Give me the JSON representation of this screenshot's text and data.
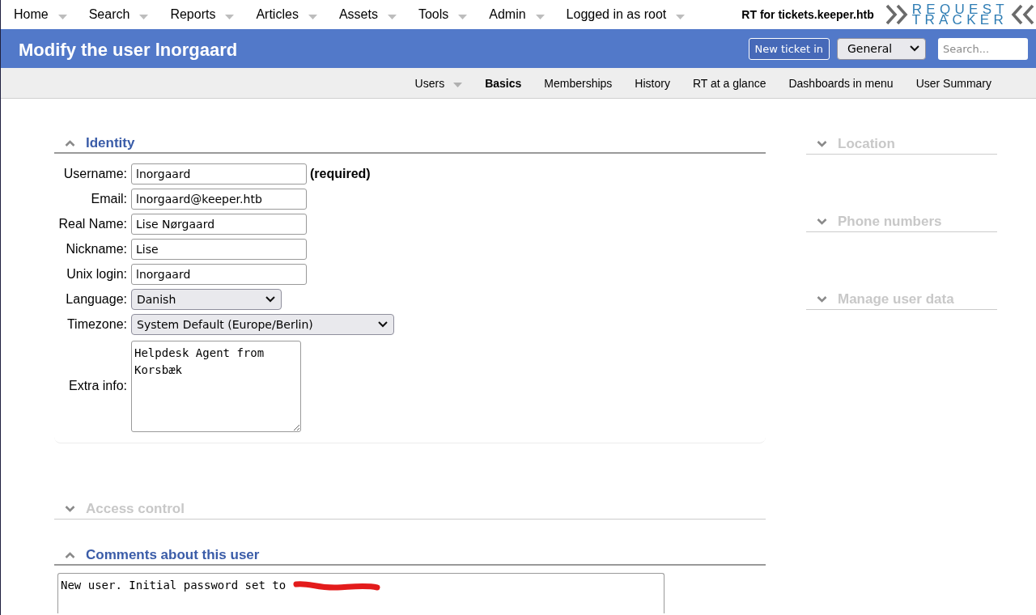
{
  "top_menu": [
    {
      "label": "Home"
    },
    {
      "label": "Search"
    },
    {
      "label": "Reports"
    },
    {
      "label": "Articles"
    },
    {
      "label": "Assets"
    },
    {
      "label": "Tools"
    },
    {
      "label": "Admin"
    },
    {
      "label": "Logged in as root"
    }
  ],
  "site_title": "RT for tickets.keeper.htb",
  "logo": {
    "lines": [
      "REQUEST",
      "TRACKER"
    ]
  },
  "page_title": "Modify the user lnorgaard",
  "header": {
    "new_ticket_button": "New ticket in",
    "queue": "General",
    "search": {
      "placeholder": "Search..."
    }
  },
  "tabs": [
    {
      "label": "Users",
      "selected": false,
      "has_menu": true
    },
    {
      "label": "Basics",
      "selected": true,
      "has_menu": false
    },
    {
      "label": "Memberships",
      "selected": false,
      "has_menu": false
    },
    {
      "label": "History",
      "selected": false,
      "has_menu": false
    },
    {
      "label": "RT at a glance",
      "selected": false,
      "has_menu": false
    },
    {
      "label": "Dashboards in menu",
      "selected": false,
      "has_menu": false
    },
    {
      "label": "User Summary",
      "selected": false,
      "has_menu": false
    }
  ],
  "main_sections": [
    {
      "title": "Identity",
      "expanded": true,
      "fields": [
        {
          "kind": "input",
          "label": "Username:",
          "value": "lnorgaard",
          "note": "(required)"
        },
        {
          "kind": "input",
          "label": "Email:",
          "value": "lnorgaard@keeper.htb"
        },
        {
          "kind": "input",
          "label": "Real Name:",
          "value": "Lise Nørgaard"
        },
        {
          "kind": "input",
          "label": "Nickname:",
          "value": "Lise"
        },
        {
          "kind": "input",
          "label": "Unix login:",
          "value": "lnorgaard"
        },
        {
          "kind": "select",
          "label": "Language:",
          "value": "Danish"
        },
        {
          "kind": "select",
          "label": "Timezone:",
          "value": "System Default (Europe/Berlin)"
        },
        {
          "kind": "textarea",
          "label": "Extra info:",
          "value": "Helpdesk Agent from Korsbæk"
        }
      ]
    },
    {
      "title": "Access control",
      "expanded": false
    },
    {
      "title": "Comments about this user",
      "expanded": true,
      "comment": {
        "text": "New user. Initial password set to",
        "redacted": true
      }
    }
  ],
  "side_sections": [
    {
      "title": "Location",
      "expanded": false
    },
    {
      "title": "Phone numbers",
      "expanded": false
    },
    {
      "title": "Manage user data",
      "expanded": false
    }
  ]
}
